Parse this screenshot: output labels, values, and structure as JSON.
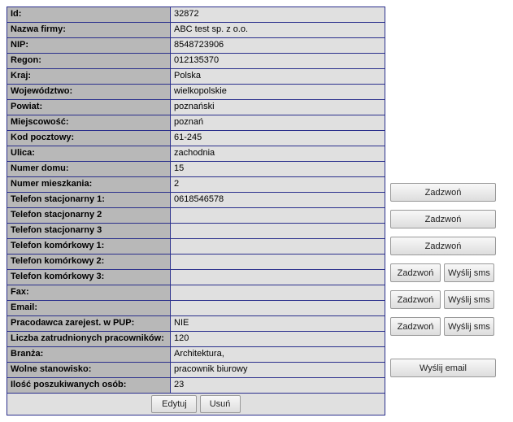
{
  "rows": {
    "id_label": "Id:",
    "id_value": "32872",
    "name_label": "Nazwa firmy:",
    "name_value": "ABC test sp. z o.o.",
    "nip_label": "NIP:",
    "nip_value": "8548723906",
    "regon_label": "Regon:",
    "regon_value": "012135370",
    "country_label": "Kraj:",
    "country_value": "Polska",
    "voivodeship_label": "Województwo:",
    "voivodeship_value": "wielkopolskie",
    "county_label": "Powiat:",
    "county_value": "poznański",
    "city_label": "Miejscowość:",
    "city_value": "poznań",
    "postcode_label": "Kod pocztowy:",
    "postcode_value": "61-245",
    "street_label": "Ulica:",
    "street_value": "zachodnia",
    "house_label": "Numer domu:",
    "house_value": "15",
    "apt_label": "Numer mieszkania:",
    "apt_value": "2",
    "phone1_label": "Telefon stacjonarny 1:",
    "phone1_value": "0618546578",
    "phone2_label": "Telefon stacjonarny 2",
    "phone2_value": "",
    "phone3_label": "Telefon stacjonarny 3",
    "phone3_value": "",
    "mobile1_label": "Telefon komórkowy 1:",
    "mobile1_value": "",
    "mobile2_label": "Telefon komórkowy 2:",
    "mobile2_value": "",
    "mobile3_label": "Telefon komórkowy 3:",
    "mobile3_value": "",
    "fax_label": "Fax:",
    "fax_value": "",
    "email_label": "Email:",
    "email_value": "",
    "pup_label": "Pracodawca zarejest. w PUP:",
    "pup_value": "NIE",
    "emp_label": "Liczba zatrudnionych pracowników:",
    "emp_value": "120",
    "industry_label": "Branża:",
    "industry_value": "Architektura,",
    "position_label": "Wolne stanowisko:",
    "position_value": "pracownik biurowy",
    "seeking_label": "Ilość poszukiwanych osób:",
    "seeking_value": "23"
  },
  "buttons": {
    "edit": "Edytuj",
    "delete": "Usuń",
    "call": "Zadzwoń",
    "sms": "Wyślij sms",
    "email": "Wyślij email"
  }
}
